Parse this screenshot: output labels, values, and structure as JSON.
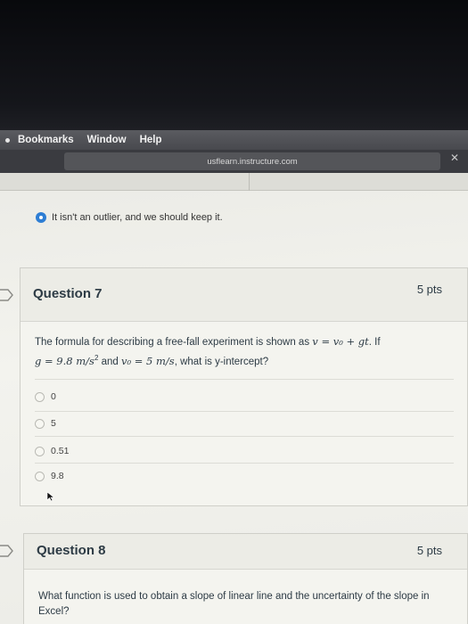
{
  "menubar": {
    "items": [
      "Bookmarks",
      "Window",
      "Help"
    ]
  },
  "browser": {
    "url": "usflearn.instructure.com"
  },
  "prev_answer": {
    "label": "It isn't an outlier, and we should keep it."
  },
  "question7": {
    "title": "Question 7",
    "points": "5 pts",
    "text_line1_prefix": "The formula for describing a free-fall experiment is shown as",
    "text_line1_formula": "v = v₀ + gt",
    "text_line1_suffix": ". If",
    "text_line2_g": "g = 9.8 m/s",
    "text_line2_exp": "2",
    "text_line2_mid": " and ",
    "text_line2_v0": "v₀ = 5 m/s",
    "text_line2_suffix": ", what is y-intercept?",
    "options": [
      "0",
      "5",
      "0.51",
      "9.8"
    ]
  },
  "question8": {
    "title": "Question 8",
    "points": "5 pts",
    "text": "What function is used to obtain a slope of linear line and the uncertainty of the slope in Excel?"
  }
}
